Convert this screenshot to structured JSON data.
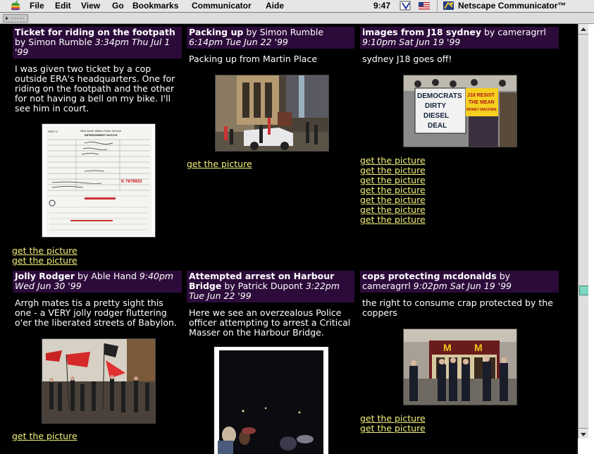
{
  "menubar": {
    "menus": [
      "File",
      "Edit",
      "View",
      "Go",
      "Bookmarks",
      "Communicator",
      "Aide"
    ],
    "clock": "9:47",
    "app_name": "Netscape Communicator™"
  },
  "icons": {
    "apple": "apple-icon",
    "script": "script-menu-icon",
    "flag": "us-flag-icon",
    "app": "netscape-icon"
  },
  "colors": {
    "page_background": "#000000",
    "header_background": "#2c0b3a",
    "link_color": "#f3f079"
  },
  "stories": [
    {
      "title": "Ticket for riding on the footpath",
      "author": "by Simon Rumble",
      "date": "3:34pm Thu Jul 1 '99",
      "body": "I was given two ticket by a cop outside ERA's headquarters. One for riding on the footpath and the other for not having a bell on my bike. I'll see him in court.",
      "links": [
        "get the picture",
        "get the picture"
      ]
    },
    {
      "title": "Packing up",
      "author": "by Simon Rumble",
      "date": "6:14pm Tue Jun 22 '99",
      "body": "Packing up from Martin Place",
      "links": [
        "get the picture"
      ]
    },
    {
      "title": "images from J18 sydney",
      "author": "by cameragrrl",
      "date": "9:10pm Sat Jun 19 '99",
      "body": "sydney J18 goes off!",
      "links": [
        "get the picture",
        "get the picture",
        "get the picture",
        "get the picture",
        "get the picture",
        "get the picture",
        "get the picture"
      ]
    },
    {
      "title": "Jolly Rodger",
      "author": "by Able Hand",
      "date": "9:40pm Wed Jun 30 '99",
      "body": "Arrgh mates tis a pretty sight this one - a VERY jolly rodger fluttering o'er the liberated streets of Babylon.",
      "links": [
        "get the picture"
      ]
    },
    {
      "title": "Attempted arrest on Harbour Bridge",
      "author": "by Patrick Dupont",
      "date": "3:22pm Tue Jun 22 '99",
      "body": "Here we see an overzealous Police officer attempting to arrest a Critical Masser on the Harbour Bridge.",
      "links": []
    },
    {
      "title": "cops protecting mcdonalds",
      "author": "by cameragrrl",
      "date": "9:02pm Sat Jun 19 '99",
      "body": "the right to consume crap protected by the coppers",
      "links": [
        "get the picture",
        "get the picture"
      ]
    }
  ],
  "photo_text": {
    "ticket": {
      "part": "PART C",
      "agency": "New South Wales Police Service",
      "notice": "INFRINGEMENT NOTICE",
      "number": "K 7679933"
    },
    "democrats_sign": [
      "DEMOCRATS",
      "DIRTY",
      "DIESEL",
      "DEAL"
    ],
    "j18_sign": [
      "J18 RESIST",
      "THE MEAN",
      "MONEY MACHINE"
    ]
  }
}
